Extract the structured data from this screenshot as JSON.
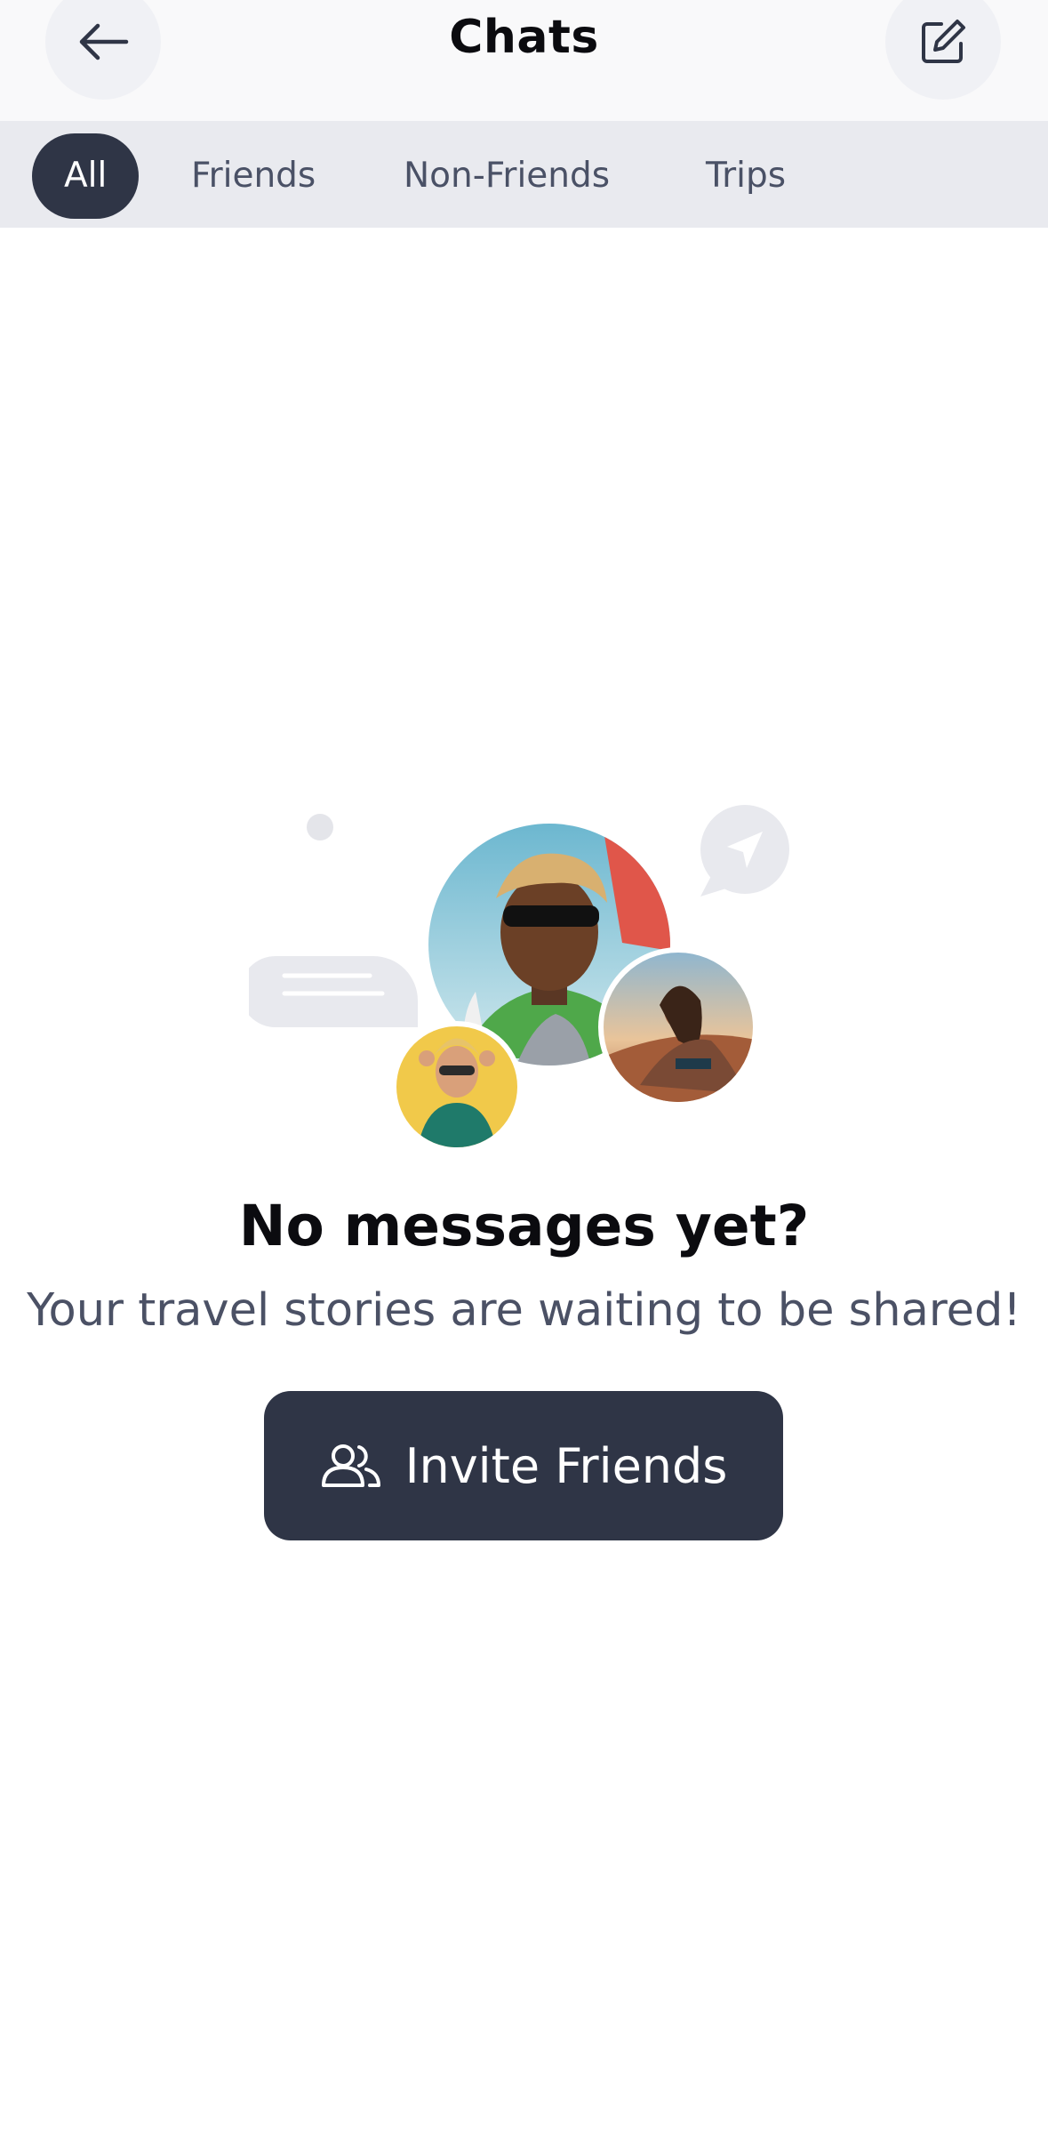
{
  "header": {
    "title": "Chats",
    "back_icon": "arrow-left-icon",
    "compose_icon": "compose-icon"
  },
  "tabs": [
    {
      "label": "All",
      "active": true
    },
    {
      "label": "Friends",
      "active": false
    },
    {
      "label": "Non-Friends",
      "active": false
    },
    {
      "label": "Trips",
      "active": false
    }
  ],
  "empty_state": {
    "title": "No messages yet?",
    "subtitle": "Your travel stories are waiting to be shared!",
    "button_label": "Invite Friends",
    "button_icon": "users-icon"
  },
  "colors": {
    "primary": "#2f3546",
    "tab_bar": "#e9eaef",
    "header_bg": "#f9f9fa",
    "muted_text": "#4b5165"
  }
}
